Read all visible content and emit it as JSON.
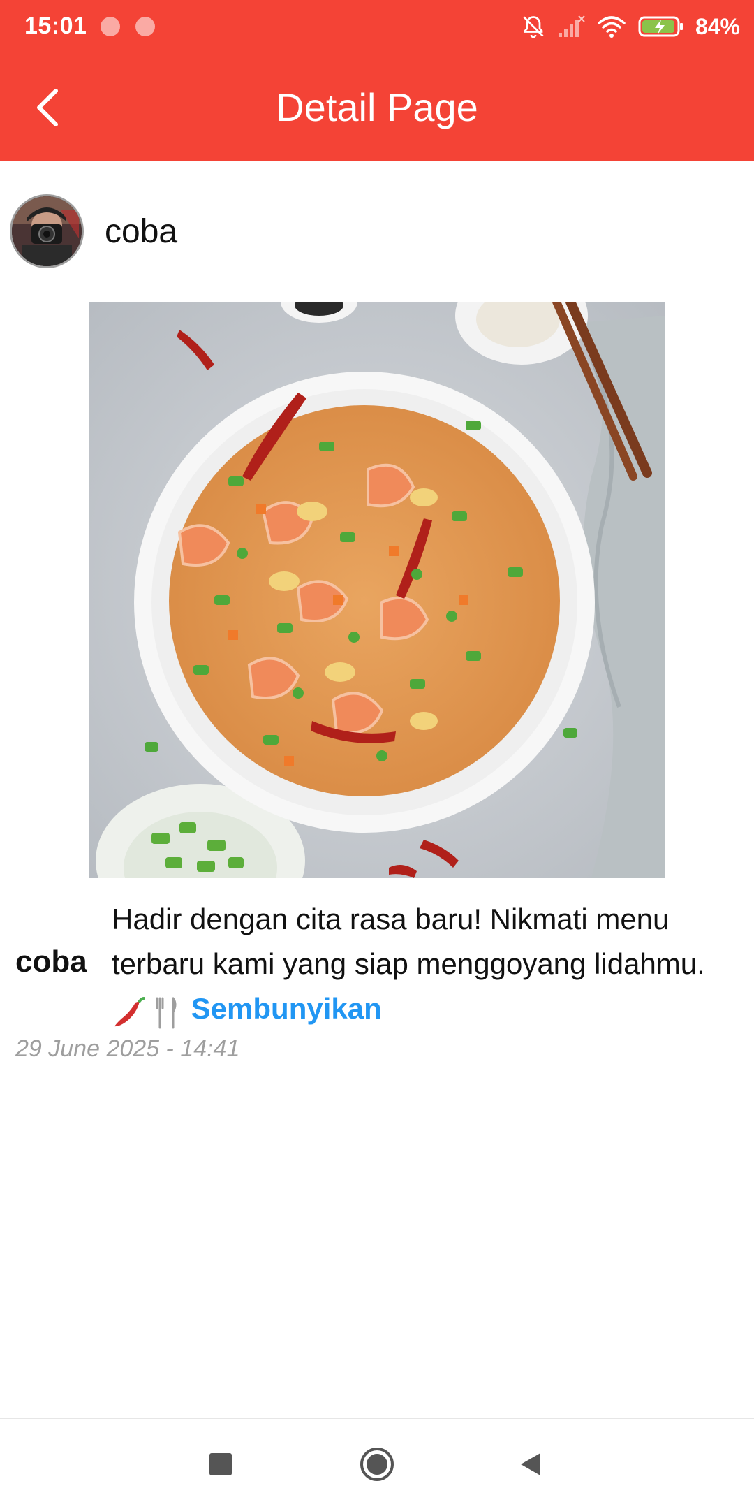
{
  "status_bar": {
    "time": "15:01",
    "battery": "84%",
    "icons": [
      "notification-dot-icon",
      "notification-dot-icon",
      "bell-off-icon",
      "signal-icon",
      "wifi-icon",
      "battery-charging-icon"
    ]
  },
  "app_bar": {
    "title": "Detail Page",
    "back_icon": "chevron-left-icon"
  },
  "author": {
    "name": "coba"
  },
  "post": {
    "image": "fried-rice-photo",
    "caption_author": "coba",
    "caption_line_1": "Hadir dengan cita rasa baru! Nikmati menu",
    "caption_line_2": "terbaru kami yang siap menggoyang lidahmu.",
    "caption_emoji": "🌶️🍴",
    "hide_label": "Sembunyikan",
    "date": "29 June 2025 - 14:41"
  },
  "nav_bar": {
    "icons": [
      "recent-apps-icon",
      "home-icon",
      "back-icon"
    ]
  },
  "colors": {
    "primary": "#F44336",
    "link": "#2196F3",
    "muted": "#9E9E9E"
  }
}
